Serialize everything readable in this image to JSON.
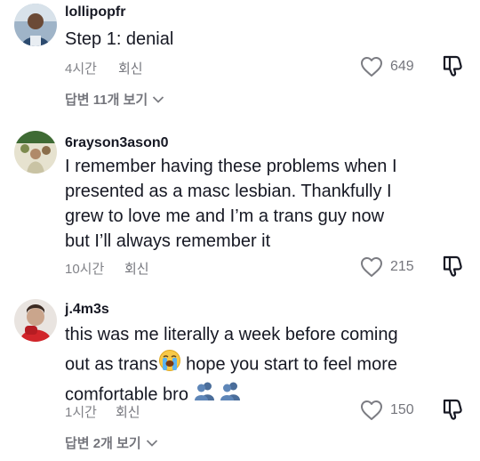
{
  "comments": [
    {
      "username": "lollipopfr",
      "lines": [
        "Step 1: denial"
      ],
      "time": "4시간",
      "reply_label": "회신",
      "likes": "649",
      "view_replies": "답변 11개 보기",
      "like_icon": "heart-outline-icon",
      "dislike_icon": "thumbs-down-icon"
    },
    {
      "username": "6rayson3ason0",
      "lines": [
        "I remember having these problems when I",
        "presented as a masc lesbian. Thankfully I",
        "grew to love me and I’m a trans guy now",
        "but I’ll always remember it"
      ],
      "time": "10시간",
      "reply_label": "회신",
      "likes": "215",
      "like_icon": "heart-outline-icon",
      "dislike_icon": "thumbs-down-icon"
    },
    {
      "username": "j.4m3s",
      "lines": [
        "this was me literally a week before coming",
        "out as trans",
        " hope you start to feel more",
        "comfortable bro"
      ],
      "time": "1시간",
      "reply_label": "회신",
      "likes": "150",
      "view_replies": "답변 2개 보기",
      "emojis": [
        "crying-face-emoji",
        "busts-in-silhouette-emoji"
      ],
      "like_icon": "heart-outline-icon",
      "dislike_icon": "thumbs-down-icon"
    }
  ],
  "colors": {
    "text": "#161823",
    "secondary": "#8a8b91",
    "background": "#ffffff"
  }
}
